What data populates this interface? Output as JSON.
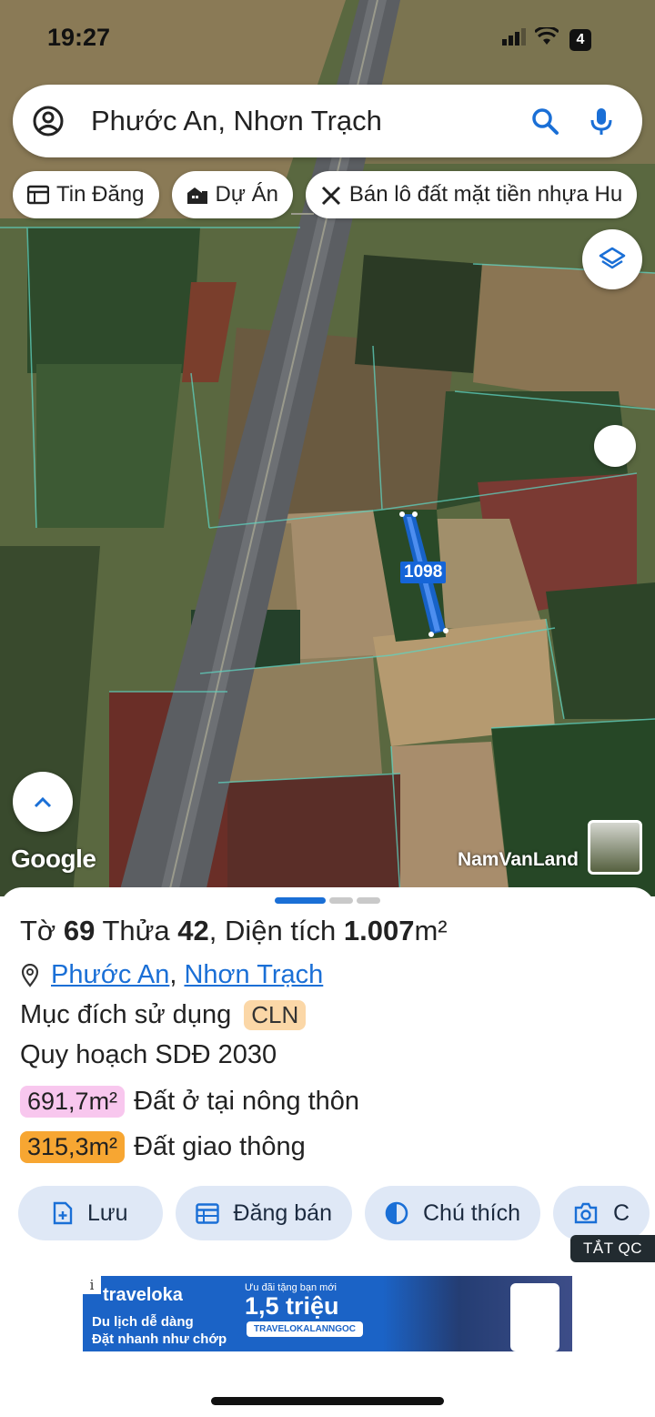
{
  "status_bar": {
    "time": "19:27",
    "battery": "4"
  },
  "search": {
    "query": "Phước An, Nhơn Trạch"
  },
  "chips": [
    {
      "label": "Tin Đăng",
      "icon": "listing-icon"
    },
    {
      "label": "Dự Án",
      "icon": "project-icon"
    },
    {
      "label": "Bán lô đất mặt tiền nhựa Hu",
      "icon": "tools-icon"
    }
  ],
  "map": {
    "parcel_label": "1098",
    "google_logo": "Google",
    "watermark": "NamVanLand"
  },
  "sheet": {
    "title_parts": {
      "to_label": "Tờ",
      "to_value": "69",
      "thua_label": "Thửa",
      "thua_value": "42",
      "area_label": ", Diện tích",
      "area_value": "1.007",
      "area_unit": "m²"
    },
    "location": {
      "ward": "Phước An",
      "district": "Nhơn Trạch",
      "sep": ","
    },
    "usage_label": "Mục đích sử dụng",
    "usage_code": "CLN",
    "plan_label": "Quy hoạch SDĐ 2030",
    "plan_items": [
      {
        "area": "691,7m²",
        "label": "Đất ở tại nông thôn",
        "color": "#f8c7ee"
      },
      {
        "area": "315,3m²",
        "label": "Đất giao thông",
        "color": "#f7a632"
      }
    ],
    "actions": [
      {
        "label": "Lưu",
        "icon": "save-icon"
      },
      {
        "label": "Đăng bán",
        "icon": "calendar-icon"
      },
      {
        "label": "Chú thích",
        "icon": "legend-icon"
      },
      {
        "label": "C",
        "icon": "camera-icon"
      }
    ],
    "close_ads": "TẮT QC"
  },
  "ad": {
    "brand": "traveloka",
    "line1": "Du lịch dễ dàng",
    "line2": "Đặt nhanh như chớp",
    "promo": "Ưu đãi tặng bạn mới",
    "amount": "1,5 triệu",
    "code": "TRAVELOKALANNGOC",
    "info": "i"
  },
  "colors": {
    "accent": "#1a6fd6",
    "action_bg": "#dfe8f6",
    "parcel": "#1565d8"
  }
}
